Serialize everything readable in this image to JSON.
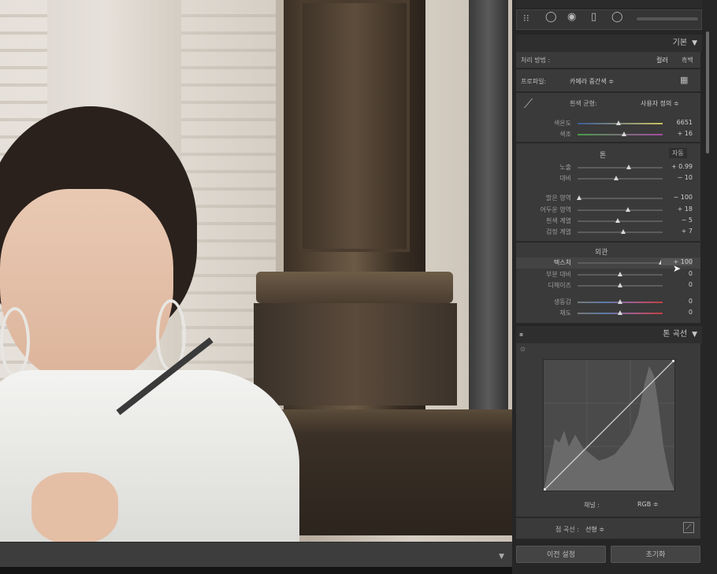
{
  "toolbar": {
    "icons": [
      "grid-tool-icon",
      "circle-tool-icon",
      "radial-filter-icon",
      "crop-icon",
      "spot-icon",
      "slider-icon"
    ]
  },
  "basic": {
    "header": "기본",
    "treatment_label": "처리 방법 :",
    "treatment_color": "컬러",
    "treatment_bw": "흑백",
    "profile_label": "프로파일:",
    "profile_value": "카메라 중간색 ≑",
    "wb_label": "흰색 균형:",
    "wb_value": "사용자 정의 ≑",
    "temp_label": "색온도",
    "temp_value": "6651",
    "temp_pos": 0.48,
    "tint_label": "색조",
    "tint_value": "+ 16",
    "tint_pos": 0.55,
    "tone_title": "톤",
    "tone_auto": "자동",
    "exposure_label": "노출",
    "exposure_value": "+ 0.99",
    "exposure_pos": 0.6,
    "contrast_label": "대비",
    "contrast_value": "− 10",
    "contrast_pos": 0.45,
    "highlights_label": "밝은 영역",
    "highlights_value": "− 100",
    "highlights_pos": 0.02,
    "shadows_label": "어두운 영역",
    "shadows_value": "+ 18",
    "shadows_pos": 0.59,
    "whites_label": "흰색 계열",
    "whites_value": "− 5",
    "whites_pos": 0.47,
    "blacks_label": "검정 계열",
    "blacks_value": "+ 7",
    "blacks_pos": 0.54,
    "presence_title": "외관",
    "texture_label": "텍스처",
    "texture_value": "+ 100",
    "texture_pos": 0.98,
    "clarity_label": "부분 대비",
    "clarity_value": "0",
    "clarity_pos": 0.5,
    "dehaze_label": "디헤이즈",
    "dehaze_value": "0",
    "dehaze_pos": 0.5,
    "vibrance_label": "생동감",
    "vibrance_value": "0",
    "vibrance_pos": 0.5,
    "saturation_label": "채도",
    "saturation_value": "0",
    "saturation_pos": 0.5
  },
  "tonecurve": {
    "header": "톤 곡선",
    "channel_label": "채널 :",
    "channel_value": "RGB ≑",
    "point_curve_label": "점 곡선 :",
    "point_curve_value": "선형 ≑"
  },
  "buttons": {
    "previous": "이전 설정",
    "reset": "초기화"
  }
}
